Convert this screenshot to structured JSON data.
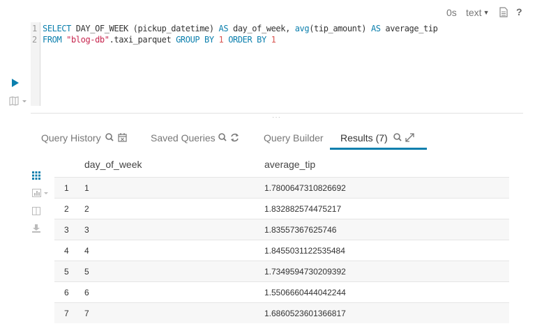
{
  "toolbar": {
    "execution_time": "0s",
    "result_format": "text",
    "doc_icon": "document-icon",
    "help_label": "?"
  },
  "editor": {
    "line_numbers": [
      "1",
      "2"
    ],
    "line1": {
      "t1": "SELECT",
      "t2": " DAY_OF_WEEK (pickup_datetime) ",
      "t3": "AS",
      "t4": " day_of_week, ",
      "t5": "avg",
      "t6": "(tip_amount) ",
      "t7": "AS",
      "t8": " average_tip"
    },
    "line2": {
      "t1": "FROM",
      "t2": " ",
      "t3": "\"blog-db\"",
      "t4": ".taxi_parquet ",
      "t5": "GROUP BY",
      "t6": " ",
      "t7": "1",
      "t8": " ",
      "t9": "ORDER BY",
      "t10": " ",
      "t11": "1"
    }
  },
  "splitter_grip": "···",
  "tabs": [
    {
      "label": "Query History"
    },
    {
      "label": "Saved Queries"
    },
    {
      "label": "Query Builder"
    },
    {
      "label": "Results (7)"
    }
  ],
  "table": {
    "columns": [
      "day_of_week",
      "average_tip"
    ],
    "rows": [
      {
        "index": "1",
        "day_of_week": "1",
        "average_tip": "1.7800647310826692"
      },
      {
        "index": "2",
        "day_of_week": "2",
        "average_tip": "1.832882574475217"
      },
      {
        "index": "3",
        "day_of_week": "3",
        "average_tip": "1.83557367625746"
      },
      {
        "index": "4",
        "day_of_week": "4",
        "average_tip": "1.8455031122535484"
      },
      {
        "index": "5",
        "day_of_week": "5",
        "average_tip": "1.7349594730209392"
      },
      {
        "index": "6",
        "day_of_week": "6",
        "average_tip": "1.5506660444042244"
      },
      {
        "index": "7",
        "day_of_week": "7",
        "average_tip": "1.6860523601366817"
      }
    ]
  },
  "colors": {
    "accent": "#0b7fad",
    "keyword": "#0b7fad",
    "string": "#c7254e",
    "number": "#d9534f"
  }
}
